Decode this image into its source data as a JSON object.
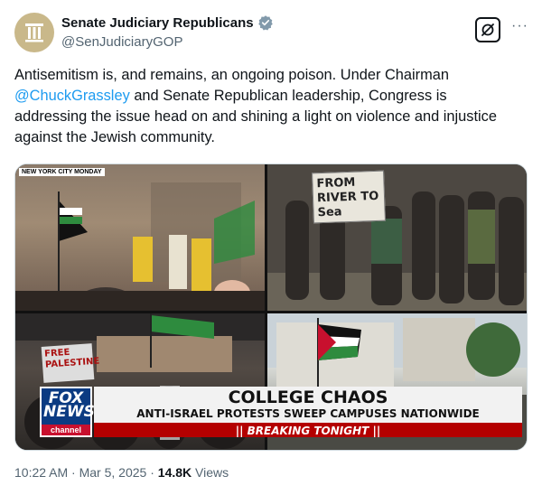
{
  "author": {
    "display_name": "Senate Judiciary Republicans",
    "handle": "@SenJudiciaryGOP",
    "verified": true,
    "avatar_icon": "pillar-seal-icon",
    "avatar_color": "#c9b88a"
  },
  "actions": {
    "grok_icon": "grok-icon",
    "more_label": "···"
  },
  "tweet": {
    "text_before": "Antisemitism is, and remains, an ongoing poison. Under Chairman ",
    "mention": "@ChuckGrassley",
    "text_after": " and Senate Republican leadership, Congress is addressing the issue head on and shining a light on violence and injustice against the Jewish community."
  },
  "media": {
    "location_label": "NEW YORK CITY MONDAY",
    "sign_river": "FROM RIVER TO Sea",
    "sign_free": "FREE PALESTINE",
    "fox_logo": "FOX NEWS",
    "fox_channel": "channel",
    "headline": "COLLEGE CHAOS",
    "subhead": "ANTI-ISRAEL PROTESTS SWEEP CAMPUSES NATIONWIDE",
    "breaking": "|| BREAKING TONIGHT ||"
  },
  "meta": {
    "time": "10:22 AM",
    "sep1": " · ",
    "date": "Mar 5, 2025",
    "sep2": " · ",
    "views_count": "14.8K",
    "views_label": " Views"
  },
  "colors": {
    "link": "#1d9bf0",
    "verified_badge": "#829aab",
    "fox_blue": "#0b3b82",
    "breaking_red": "#b40000"
  }
}
